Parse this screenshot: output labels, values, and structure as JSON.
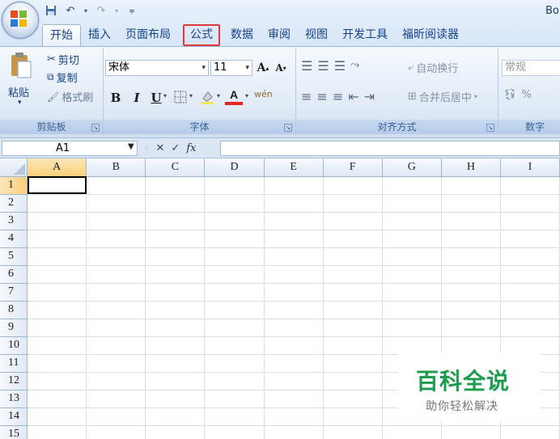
{
  "window": {
    "title_fragment": "Bo"
  },
  "tabs": [
    "开始",
    "插入",
    "页面布局",
    "公式",
    "数据",
    "审阅",
    "视图",
    "开发工具",
    "福昕阅读器"
  ],
  "active_tab": "开始",
  "highlighted_tab": "公式",
  "clipboard": {
    "paste_label": "粘贴",
    "cut_label": "剪切",
    "copy_label": "复制",
    "format_painter_label": "格式刷",
    "group_label": "剪贴板"
  },
  "font": {
    "font_name": "宋体",
    "font_size": "11",
    "grow_label": "A",
    "shrink_label": "A",
    "bold": "B",
    "italic": "I",
    "underline": "U",
    "font_color_label": "A",
    "phonetic_label": "wén",
    "group_label": "字体"
  },
  "alignment": {
    "wrap_text_label": "自动换行",
    "merge_center_label": "合并后居中",
    "group_label": "对齐方式"
  },
  "number": {
    "format_value": "常规",
    "percent_label": "%",
    "group_label": "数字"
  },
  "formula_bar": {
    "name_box": "A1",
    "fx_label": "fx",
    "cancel": "✕",
    "enter": "✓",
    "formula": ""
  },
  "columns": [
    "A",
    "B",
    "C",
    "D",
    "E",
    "F",
    "G",
    "H",
    "I"
  ],
  "rows": [
    "1",
    "2",
    "3",
    "4",
    "5",
    "6",
    "7",
    "8",
    "9",
    "10",
    "11",
    "12",
    "13",
    "14",
    "15"
  ],
  "active_cell": "A1",
  "watermark": {
    "title": "百科全说",
    "subtitle": "助你轻松解决"
  },
  "colors": {
    "highlight": "#e0393c",
    "watermark_green": "#1d9b4e",
    "selected_header": "#f9cf79"
  }
}
